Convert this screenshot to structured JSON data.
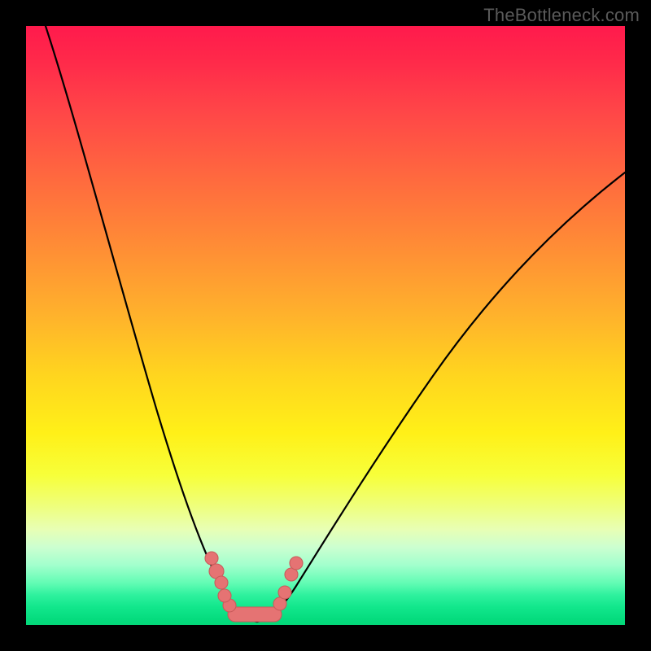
{
  "watermark": "TheBottleneck.com",
  "colors": {
    "frame": "#000000",
    "gradient_top": "#ff1a4c",
    "gradient_mid": "#fff018",
    "gradient_bottom": "#03d879",
    "curve": "#000000",
    "dots": "#e57373"
  },
  "chart_data": {
    "type": "line",
    "title": "",
    "xlabel": "",
    "ylabel": "",
    "xlim": [
      0,
      100
    ],
    "ylim": [
      0,
      100
    ],
    "curve_left": {
      "x": [
        0,
        5,
        10,
        15,
        20,
        25,
        30,
        35
      ],
      "y": [
        100,
        80,
        60,
        42,
        27,
        14,
        5,
        0
      ]
    },
    "curve_right": {
      "x": [
        35,
        40,
        45,
        50,
        55,
        60,
        65,
        70,
        75,
        80,
        85,
        90,
        95,
        100
      ],
      "y": [
        0,
        5,
        11,
        18,
        25,
        32,
        39,
        46,
        52,
        58,
        63,
        68,
        72,
        76
      ]
    },
    "marked_points": [
      {
        "x": 27,
        "y": 12
      },
      {
        "x": 28,
        "y": 9
      },
      {
        "x": 29,
        "y": 6
      },
      {
        "x": 30,
        "y": 3.5
      },
      {
        "x": 32,
        "y": 1.5
      },
      {
        "x": 34,
        "y": 0.8
      },
      {
        "x": 36,
        "y": 0.8
      },
      {
        "x": 38,
        "y": 1.5
      },
      {
        "x": 41,
        "y": 6
      },
      {
        "x": 42,
        "y": 9
      }
    ],
    "legend": [],
    "grid": false
  }
}
